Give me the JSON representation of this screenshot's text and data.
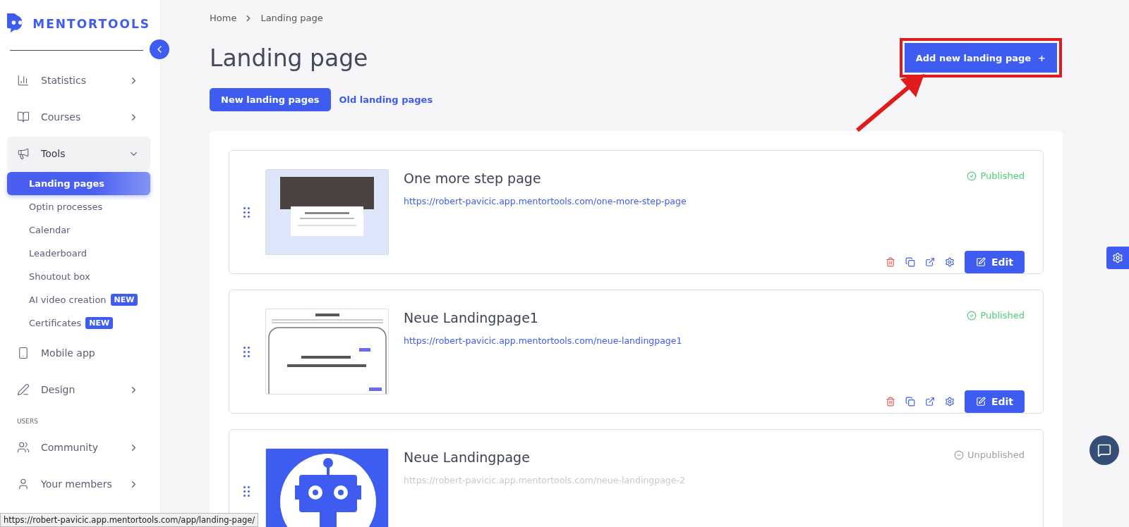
{
  "brand": {
    "name": "MENTORTOOLS"
  },
  "sidebar": {
    "items": [
      {
        "kind": "group",
        "label": "Statistics",
        "expanded": false
      },
      {
        "kind": "group",
        "label": "Courses",
        "expanded": false
      },
      {
        "kind": "group",
        "label": "Tools",
        "expanded": true,
        "children": [
          {
            "label": "Landing pages",
            "selected": true
          },
          {
            "label": "Optin processes",
            "selected": false
          },
          {
            "label": "Calendar",
            "selected": false
          },
          {
            "label": "Leaderboard",
            "selected": false
          },
          {
            "label": "Shoutout box",
            "selected": false
          },
          {
            "label": "AI video creation",
            "selected": false,
            "badge": "NEW"
          },
          {
            "label": "Certificates",
            "selected": false,
            "badge": "NEW"
          }
        ]
      },
      {
        "kind": "link",
        "label": "Mobile app"
      },
      {
        "kind": "group",
        "label": "Design",
        "expanded": false
      },
      {
        "kind": "heading",
        "label": "USERS"
      },
      {
        "kind": "group",
        "label": "Community",
        "expanded": false
      },
      {
        "kind": "group",
        "label": "Your members",
        "expanded": false
      }
    ]
  },
  "breadcrumb": [
    "Home",
    "Landing page"
  ],
  "page_title": "Landing page",
  "add_button": {
    "label": "Add new landing page",
    "icon": "+"
  },
  "tabs": [
    {
      "label": "New landing pages",
      "selected": true
    },
    {
      "label": "Old landing pages",
      "selected": false
    }
  ],
  "pages": [
    {
      "title": "One more step page",
      "url": "https://robert-pavicic.app.mentortools.com/one-more-step-page",
      "published": true,
      "status_label": "Published",
      "edit_label": "Edit"
    },
    {
      "title": "Neue Landingpage1",
      "url": "https://robert-pavicic.app.mentortools.com/neue-landingpage1",
      "published": true,
      "status_label": "Published",
      "edit_label": "Edit"
    },
    {
      "title": "Neue Landingpage",
      "url": "https://robert-pavicic.app.mentortools.com/neue-landingpage-2",
      "published": false,
      "status_label": "Unpublished"
    }
  ],
  "status_bar": {
    "url": "https://robert-pavicic.app.mentortools.com/app/landing-page/"
  }
}
